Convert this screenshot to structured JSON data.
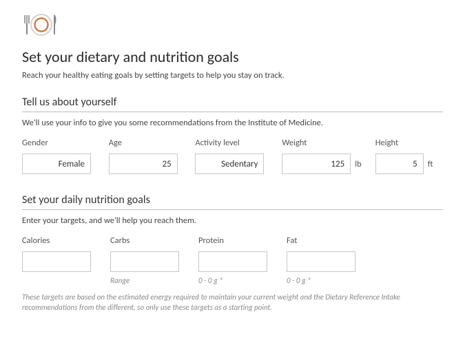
{
  "header": {
    "title": "Set your dietary and nutrition goals",
    "intro": "Reach your healthy eating goals by setting targets to help you stay on track."
  },
  "section_about": {
    "heading": "Tell us about yourself",
    "sub": "We'll use your info to give you some recommendations from the Institute of Medicine.",
    "fields": {
      "gender": {
        "label": "Gender",
        "value": "Female"
      },
      "age": {
        "label": "Age",
        "value": "25"
      },
      "activity": {
        "label": "Activity level",
        "value": "Sedentary"
      },
      "weight": {
        "label": "Weight",
        "value": "125",
        "unit": "lb"
      },
      "height": {
        "label": "Height",
        "value": "5",
        "unit": "ft"
      }
    }
  },
  "section_goals": {
    "heading": "Set your daily nutrition goals",
    "sub": "Enter your targets, and we'll help you reach them.",
    "fields": {
      "calories": {
        "label": "Calories",
        "value": "",
        "hint": ""
      },
      "carbs": {
        "label": "Carbs",
        "value": "",
        "hint": "Range"
      },
      "protein": {
        "label": "Protein",
        "value": "",
        "hint": "0 - 0 g *"
      },
      "fat": {
        "label": "Fat",
        "value": "",
        "hint": "0 - 0 g *"
      }
    }
  },
  "footnote": "These targets are based on the estimated energy required to maintain your current weight and the Dietary Reference Intake recommendations from the different, so only use these targets as a starting point."
}
